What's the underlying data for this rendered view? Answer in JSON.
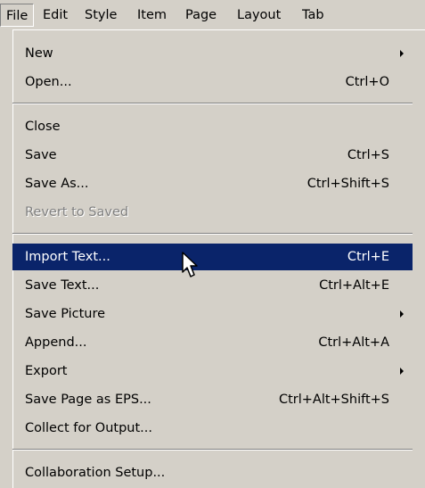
{
  "menubar": {
    "items": [
      {
        "label": "File",
        "active": true
      },
      {
        "label": "Edit"
      },
      {
        "label": "Style"
      },
      {
        "label": "Item"
      },
      {
        "label": "Page"
      },
      {
        "label": "Layout"
      },
      {
        "label": "Tab"
      }
    ]
  },
  "file_menu": {
    "items": [
      {
        "label": "New",
        "shortcut": "",
        "submenu": true
      },
      {
        "label": "Open...",
        "shortcut": "Ctrl+O"
      },
      {
        "label": "Close",
        "shortcut": ""
      },
      {
        "label": "Save",
        "shortcut": "Ctrl+S"
      },
      {
        "label": "Save As...",
        "shortcut": "Ctrl+Shift+S"
      },
      {
        "label": "Revert to Saved",
        "shortcut": "",
        "disabled": true
      },
      {
        "label": "Import Text...",
        "shortcut": "Ctrl+E",
        "highlighted": true
      },
      {
        "label": "Save Text...",
        "shortcut": "Ctrl+Alt+E"
      },
      {
        "label": "Save Picture",
        "shortcut": "",
        "submenu": true
      },
      {
        "label": "Append...",
        "shortcut": "Ctrl+Alt+A"
      },
      {
        "label": "Export",
        "shortcut": "",
        "submenu": true
      },
      {
        "label": "Save Page as EPS...",
        "shortcut": "Ctrl+Alt+Shift+S"
      },
      {
        "label": "Collect for Output...",
        "shortcut": ""
      },
      {
        "label": "Collaboration Setup...",
        "shortcut": ""
      }
    ]
  },
  "colors": {
    "menu_background": "#d4d0c8",
    "highlight_background": "#0a246a",
    "highlight_text": "#ffffff",
    "disabled_text": "#808080"
  },
  "icons": {
    "submenu_arrow": "triangle-right",
    "cursor": "arrow-pointer"
  }
}
